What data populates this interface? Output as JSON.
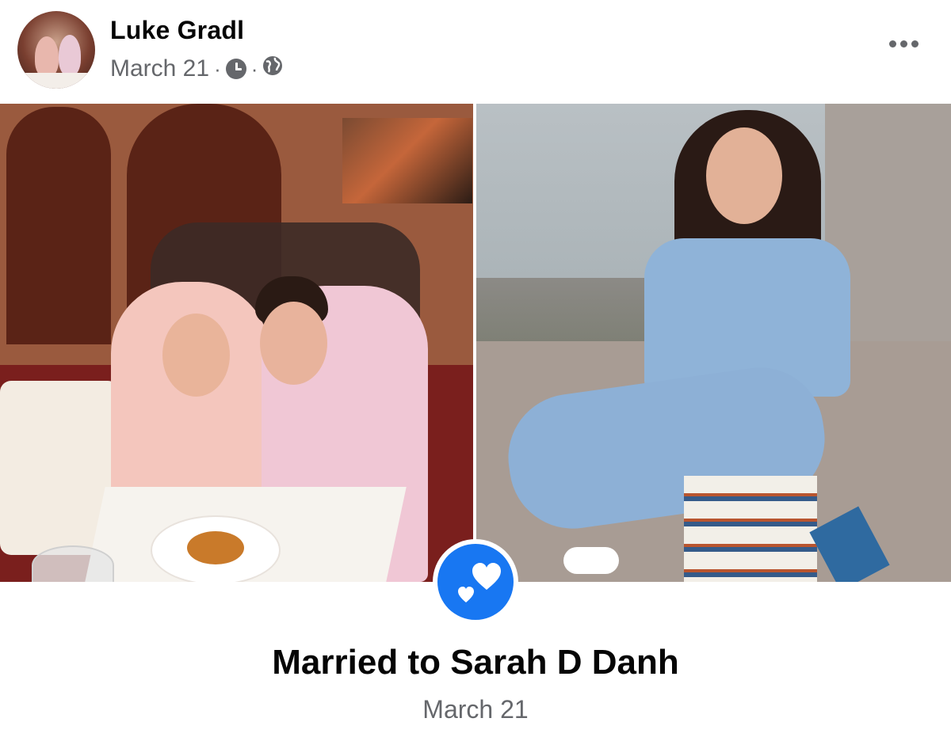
{
  "post": {
    "author": "Luke Gradl",
    "date": "March 21",
    "separator": "·",
    "icons": {
      "more": "more-options-icon",
      "clock": "clock-icon",
      "audience": "globe-icon",
      "event": "hearts-icon"
    }
  },
  "life_event": {
    "title": "Married to Sarah D Danh",
    "date": "March 21"
  },
  "colors": {
    "accent": "#1877f2",
    "secondary_text": "#65676b",
    "primary_text": "#050505"
  }
}
